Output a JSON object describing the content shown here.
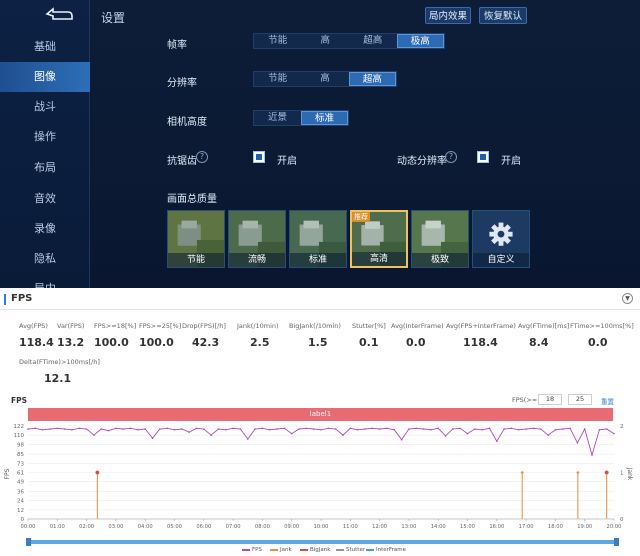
{
  "game": {
    "title": "设置",
    "top_buttons": {
      "local_effect": "局内效果",
      "restore_default": "恢复默认"
    },
    "sidebar": [
      "基础",
      "图像",
      "战斗",
      "操作",
      "布局",
      "音效",
      "录像",
      "隐私",
      "局内"
    ],
    "sidebar_active": "图像",
    "frame_rate": {
      "label": "帧率",
      "options": [
        "节能",
        "高",
        "超高",
        "极高"
      ],
      "selected": "极高"
    },
    "resolution": {
      "label": "分辨率",
      "options": [
        "节能",
        "高",
        "超高"
      ],
      "selected": "超高"
    },
    "camera_height": {
      "label": "相机高度",
      "options": [
        "近景",
        "标准"
      ],
      "selected": "标准"
    },
    "antialiasing": {
      "label": "抗锯齿",
      "checkbox_label": "开启",
      "checked": true
    },
    "dynamic_resolution": {
      "label": "动态分辨率",
      "checkbox_label": "开启",
      "checked": true
    },
    "quality": {
      "label": "画面总质量",
      "presets": [
        "节能",
        "流畅",
        "标准",
        "高清",
        "极致",
        "自定义"
      ],
      "selected": "高清",
      "badge": "推荐"
    },
    "colors": {
      "accent": "#2c6bb3",
      "panel": "#0c1a33",
      "highlight": "#f1c15a"
    }
  },
  "fps": {
    "header": "FPS",
    "metrics_row1": [
      {
        "label": "Avg(FPS)",
        "value": "118.4"
      },
      {
        "label": "Var(FPS)",
        "value": "13.2"
      },
      {
        "label": "FPS>=18[%]",
        "value": "100.0"
      },
      {
        "label": "FPS>=25[%]",
        "value": "100.0"
      },
      {
        "label": "Drop(FPS)[/h]",
        "value": "42.3"
      },
      {
        "label": "Jank(/10min)",
        "value": "2.5"
      },
      {
        "label": "BigJank(/10min)",
        "value": "1.5"
      },
      {
        "label": "Stutter[%]",
        "value": "0.1"
      },
      {
        "label": "Avg(InterFrame)",
        "value": "0.0"
      },
      {
        "label": "Avg(FPS+InterFrame)",
        "value": "118.4"
      },
      {
        "label": "Avg(FTime)[ms]",
        "value": "8.4"
      },
      {
        "label": "FTime>=100ms[%]",
        "value": "0.0"
      }
    ],
    "metrics_row2": [
      {
        "label": "Delta(FTime)>100ms[/h]",
        "value": "12.1"
      }
    ],
    "chart_title": "FPS",
    "filter_label": "FPS(>=)",
    "filter_values": [
      "18",
      "25"
    ],
    "reset_label": "重置",
    "band_label": "label1",
    "legend": [
      {
        "name": "FPS",
        "color": "#b04ab8"
      },
      {
        "name": "Jank",
        "color": "#f08a3c"
      },
      {
        "name": "BigJank",
        "color": "#d94b4b"
      },
      {
        "name": "Stutter",
        "color": "#8b95a3"
      },
      {
        "name": "InterFrame",
        "color": "#3f9fd6"
      }
    ]
  },
  "chart_data": {
    "type": "line",
    "title": "FPS",
    "ylabel": "FPS",
    "y2label": "Jank",
    "ylim": [
      0,
      122
    ],
    "y_ticks": [
      "0",
      "12",
      "24",
      "36",
      "49",
      "61",
      "73",
      "85",
      "98",
      "110",
      "122"
    ],
    "y2lim": [
      0,
      2
    ],
    "y2_ticks": [
      "0",
      "1",
      "2"
    ],
    "x_ticks": [
      "00:00",
      "01:00",
      "02:00",
      "03:00",
      "04:00",
      "05:00",
      "06:00",
      "07:00",
      "08:00",
      "09:00",
      "10:00",
      "11:00",
      "12:00",
      "13:00",
      "14:00",
      "15:00",
      "16:00",
      "17:00",
      "18:00",
      "19:00",
      "20:00"
    ],
    "fps_series": {
      "name": "FPS",
      "x": [
        0,
        0.25,
        0.5,
        0.75,
        1,
        1.25,
        1.5,
        1.75,
        2,
        2.25,
        2.5,
        2.75,
        3,
        3.25,
        3.5,
        3.75,
        4,
        4.25,
        4.5,
        4.75,
        5,
        5.25,
        5.5,
        5.75,
        6,
        6.25,
        6.5,
        6.75,
        7,
        7.25,
        7.5,
        7.75,
        8,
        8.25,
        8.5,
        8.75,
        9,
        9.25,
        9.5,
        9.75,
        10,
        10.25,
        10.5,
        10.75,
        11,
        11.25,
        11.5,
        11.75,
        12,
        12.25,
        12.5,
        12.75,
        13,
        13.25,
        13.5,
        13.75,
        14,
        14.25,
        14.5,
        14.75,
        15,
        15.25,
        15.5,
        15.75,
        16,
        16.25,
        16.5,
        16.75,
        17,
        17.25,
        17.5,
        17.75,
        18,
        18.25,
        18.5,
        18.75,
        19,
        19.25,
        19.5,
        19.75,
        20
      ],
      "y": [
        118,
        119,
        117,
        118,
        119,
        118,
        117,
        119,
        118,
        110,
        118,
        116,
        119,
        118,
        119,
        117,
        118,
        106,
        118,
        119,
        117,
        118,
        114,
        119,
        118,
        110,
        118,
        117,
        119,
        118,
        105,
        118,
        119,
        117,
        118,
        119,
        112,
        118,
        119,
        118,
        117,
        119,
        118,
        110,
        119,
        117,
        118,
        119,
        118,
        119,
        117,
        104,
        118,
        119,
        118,
        117,
        119,
        109,
        118,
        119,
        112,
        118,
        117,
        119,
        102,
        118,
        119,
        117,
        118,
        119,
        118,
        110,
        117,
        118,
        119,
        100,
        118,
        84,
        117,
        118,
        112
      ]
    },
    "jank_events": [
      {
        "time": "02:22",
        "value": 1
      },
      {
        "time": "16:52",
        "value": 1
      },
      {
        "time": "18:46",
        "value": 1
      },
      {
        "time": "19:45",
        "value": 1
      }
    ],
    "bigjank_events": [
      {
        "time": "02:22",
        "value": 1
      },
      {
        "time": "19:45",
        "value": 1
      }
    ],
    "grid": true,
    "legend_position": "bottom"
  }
}
